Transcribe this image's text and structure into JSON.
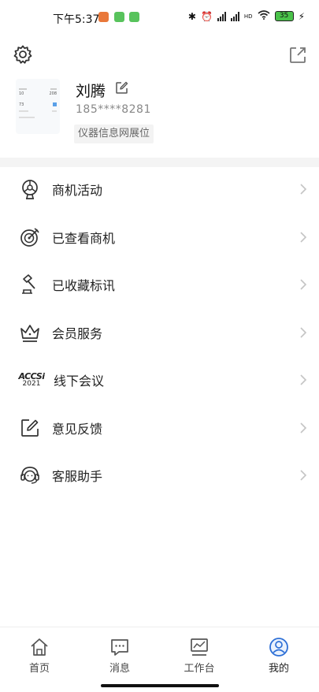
{
  "status_bar": {
    "time": "下午5:37",
    "network_label": "HD",
    "battery": "35"
  },
  "profile": {
    "name": "刘腾",
    "phone": "185****8281",
    "tag": "仪器信息网展位",
    "avatar_values": [
      "10",
      "208",
      "73"
    ]
  },
  "menu": {
    "items": [
      {
        "label": "商机活动",
        "icon": "trophy-icon"
      },
      {
        "label": "已查看商机",
        "icon": "target-icon"
      },
      {
        "label": "已收藏标讯",
        "icon": "gavel-icon"
      },
      {
        "label": "会员服务",
        "icon": "crown-icon"
      },
      {
        "label": "线下会议",
        "icon": "accsi-logo-icon"
      },
      {
        "label": "意见反馈",
        "icon": "feedback-icon"
      },
      {
        "label": "客服助手",
        "icon": "headset-icon"
      }
    ]
  },
  "logo": {
    "line1": "ACCSi",
    "line2": "2021"
  },
  "tabs": [
    {
      "label": "首页"
    },
    {
      "label": "消息"
    },
    {
      "label": "工作台"
    },
    {
      "label": "我的"
    }
  ],
  "colors": {
    "active_tab": "#2d6fd6",
    "divider": "#f4f4f4",
    "chevron": "#c4c4c4"
  }
}
